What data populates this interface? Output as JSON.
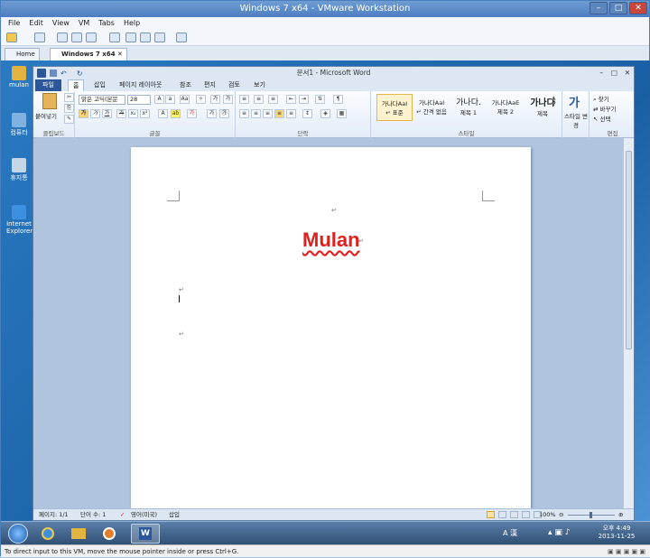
{
  "vm": {
    "title": "Windows 7 x64 - VMware Workstation",
    "menu": [
      "File",
      "Edit",
      "View",
      "VM",
      "Tabs",
      "Help"
    ],
    "tabs": [
      {
        "label": "Home"
      },
      {
        "label": "Windows 7 x64"
      }
    ],
    "status_text": "To direct input to this VM, move the mouse pointer inside or press Ctrl+G."
  },
  "desktop": {
    "icons": [
      {
        "label": "mulan",
        "icon": "folder-icon",
        "color": "#e3b341"
      },
      {
        "label": "컴퓨터",
        "icon": "computer-icon",
        "color": "#7fb2e0"
      },
      {
        "label": "휴지통",
        "icon": "recycle-bin-icon",
        "color": "#c7d6e6"
      },
      {
        "label": "Internet Explorer",
        "icon": "internet-explorer-icon",
        "color": "#3d8fe0"
      }
    ]
  },
  "word": {
    "title": "문서1 - Microsoft Word",
    "ribbon_tabs": [
      "파일",
      "홈",
      "삽입",
      "페이지 레이아웃",
      "참조",
      "편지",
      "검토",
      "보기"
    ],
    "clipboard": {
      "paste_label": "붙여넣기",
      "group": "클립보드"
    },
    "font": {
      "name": "맑은 고딕(본문",
      "size": "28",
      "group": "글꼴"
    },
    "paragraph": {
      "group": "단락"
    },
    "styles": {
      "group": "스타일",
      "items": [
        {
          "preview": "가나다AaI",
          "name": "↵ 표준"
        },
        {
          "preview": "가나다AaI",
          "name": "↵ 간격 없음"
        },
        {
          "preview": "가나다.",
          "name": "제목 1"
        },
        {
          "preview": "가나다AaE",
          "name": "제목 2"
        },
        {
          "preview": "가나다",
          "name": "제목"
        }
      ],
      "change_label": "스타일 변경"
    },
    "editing": {
      "group": "편집",
      "find": "찾기",
      "replace": "바꾸기",
      "select": "선택"
    },
    "document": {
      "heading": "Mulan",
      "para_mark": "↵"
    },
    "status": {
      "page": "페이지: 1/1",
      "words": "단어 수: 1",
      "language": "영어(미국)",
      "mode": "삽입",
      "zoom": "100%"
    }
  },
  "tray": {
    "ime": "A 漢",
    "time": "오후 4:49",
    "date": "2013-11-25"
  },
  "colors": {
    "heading": "#e0201c",
    "accent": "#2b579a"
  }
}
